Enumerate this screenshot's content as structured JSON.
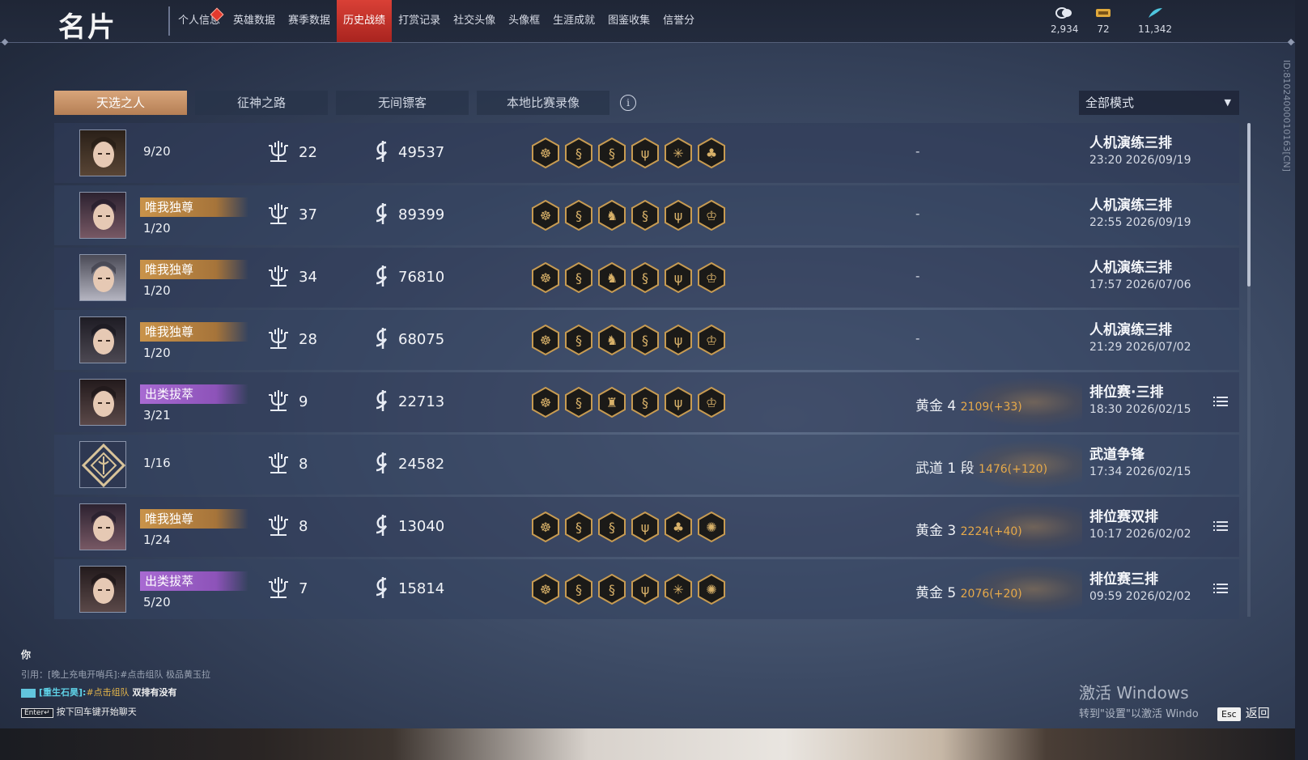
{
  "header": {
    "title": "名片",
    "nav": [
      "个人信息",
      "英雄数据",
      "赛季数据",
      "历史战绩",
      "打赏记录",
      "社交头像",
      "头像框",
      "生涯成就",
      "图鉴收集",
      "信誉分"
    ],
    "active_nav": "历史战绩",
    "currencies": [
      {
        "icon": "coin-icon",
        "value": "2,934"
      },
      {
        "icon": "ticket-icon",
        "value": "72"
      },
      {
        "icon": "feather-icon",
        "value": "11,342"
      }
    ]
  },
  "tabs": [
    "天选之人",
    "征神之路",
    "无间镖客",
    "本地比赛录像"
  ],
  "active_tab": "天选之人",
  "mode_select": {
    "value": "全部模式"
  },
  "rows": [
    {
      "avatar": "warrior",
      "tag": "",
      "tag_color": "",
      "rank": "9/20",
      "kills": "22",
      "gold": "49537",
      "icons": [
        "lion",
        "dragon",
        "dragon",
        "trident",
        "star",
        "cluster"
      ],
      "tier": "-",
      "tier_pts": "",
      "mode": "人机演练三排",
      "time": "23:20 2026/09/19",
      "has_list": false
    },
    {
      "avatar": "maiden",
      "tag": "唯我独尊",
      "tag_color": "gold",
      "rank": "1/20",
      "kills": "37",
      "gold": "89399",
      "icons": [
        "lion",
        "dragon",
        "cat",
        "dragon",
        "trident",
        "crown"
      ],
      "tier": "-",
      "tier_pts": "",
      "mode": "人机演练三排",
      "time": "22:55 2026/09/19",
      "has_list": false
    },
    {
      "avatar": "masked",
      "tag": "唯我独尊",
      "tag_color": "gold",
      "rank": "1/20",
      "kills": "34",
      "gold": "76810",
      "icons": [
        "lion",
        "dragon",
        "cat",
        "dragon",
        "trident",
        "crown"
      ],
      "tier": "-",
      "tier_pts": "",
      "mode": "人机演练三排",
      "time": "17:57 2026/07/06",
      "has_list": false
    },
    {
      "avatar": "youth",
      "tag": "唯我独尊",
      "tag_color": "gold",
      "rank": "1/20",
      "kills": "28",
      "gold": "68075",
      "icons": [
        "lion",
        "dragon",
        "cat",
        "dragon",
        "trident",
        "crown"
      ],
      "tier": "-",
      "tier_pts": "",
      "mode": "人机演练三排",
      "time": "21:29 2026/07/02",
      "has_list": false
    },
    {
      "avatar": "assassin",
      "tag": "出类拔萃",
      "tag_color": "purple",
      "rank": "3/21",
      "kills": "9",
      "gold": "22713",
      "icons": [
        "lion",
        "dragon",
        "helmet",
        "dragon",
        "trident",
        "crown"
      ],
      "tier": "黄金 4",
      "tier_pts": "2109(+33)",
      "mode": "排位赛·三排",
      "time": "18:30 2026/02/15",
      "has_list": true
    },
    {
      "avatar": "emblem",
      "tag": "",
      "tag_color": "",
      "rank": "1/16",
      "kills": "8",
      "gold": "24582",
      "icons": [],
      "tier": "武道 1 段",
      "tier_pts": "1476(+120)",
      "mode": "武道争锋",
      "time": "17:34 2026/02/15",
      "has_list": false
    },
    {
      "avatar": "maiden",
      "tag": "唯我独尊",
      "tag_color": "gold",
      "rank": "1/24",
      "kills": "8",
      "gold": "13040",
      "icons": [
        "lion",
        "dragon",
        "dragon",
        "trident",
        "cluster",
        "sun"
      ],
      "tier": "黄金 3",
      "tier_pts": "2224(+40)",
      "mode": "排位赛双排",
      "time": "10:17 2026/02/02",
      "has_list": true
    },
    {
      "avatar": "assassin",
      "tag": "出类拔萃",
      "tag_color": "purple",
      "rank": "5/20",
      "kills": "7",
      "gold": "15814",
      "icons": [
        "lion",
        "dragon",
        "dragon",
        "trident",
        "star",
        "sun"
      ],
      "tier": "黄金 5",
      "tier_pts": "2076(+20)",
      "mode": "排位赛三排",
      "time": "09:59 2026/02/02",
      "has_list": true
    }
  ],
  "chat": {
    "you": "你",
    "quote": "引用：[晚上充电开哨兵]:#点击组队 极品黄玉拉",
    "sender": "[重生石昊]:",
    "link": "#点击组队",
    "text": " 双排有没有",
    "enter_key": "Enter↵",
    "hint": "按下回车键开始聊天"
  },
  "side_id": "ID:8102400001016​3[CN]",
  "activate": {
    "title": "激活 Windows",
    "subtitle": "转到\"设置\"以激活 Windo"
  },
  "esc": {
    "key": "Esc",
    "label": "返回"
  }
}
